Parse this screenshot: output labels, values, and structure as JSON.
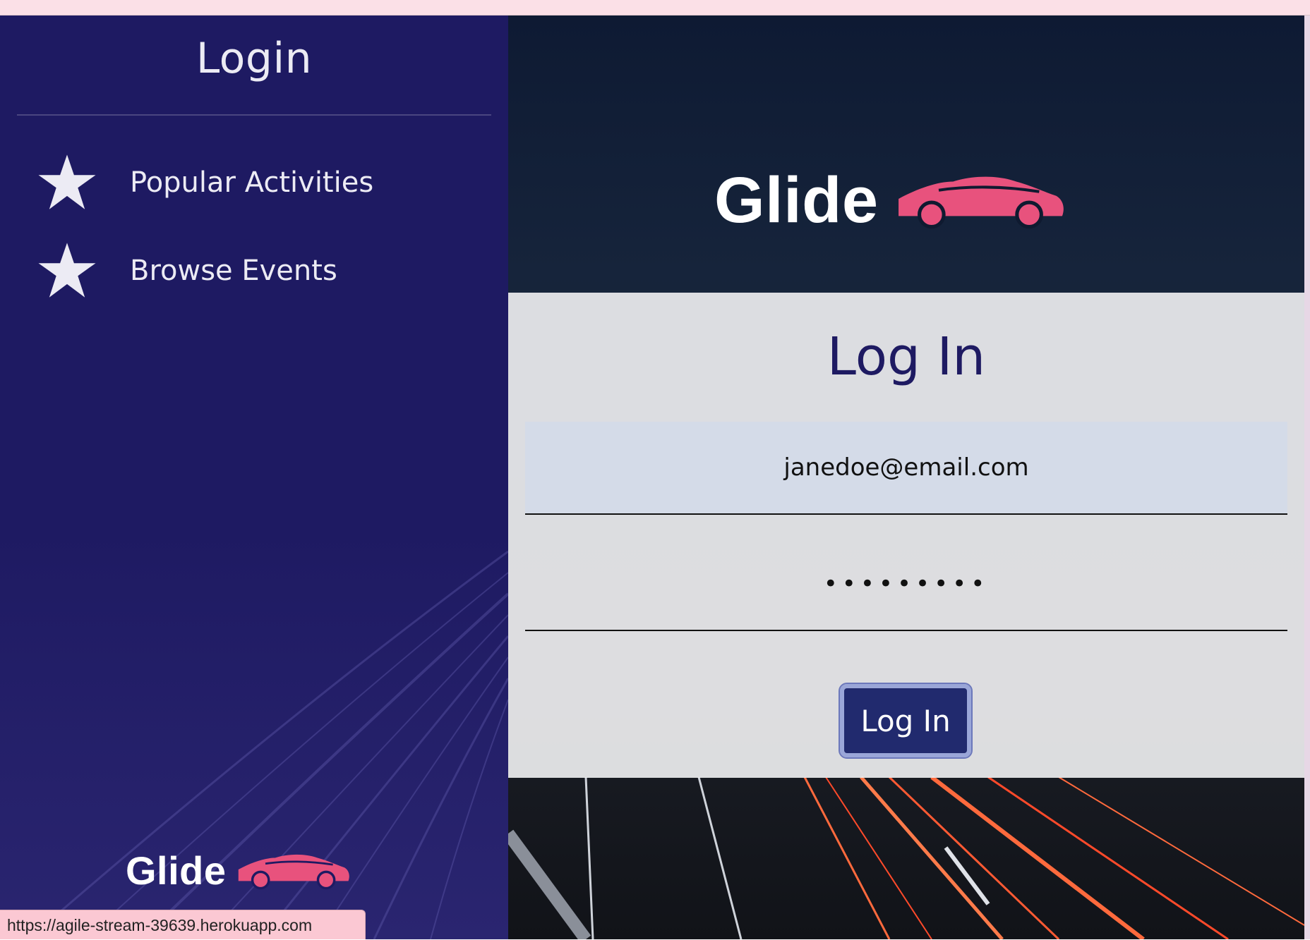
{
  "sidebar": {
    "title": "Login",
    "items": [
      {
        "label": "Popular Activities",
        "icon": "star-icon"
      },
      {
        "label": "Browse Events",
        "icon": "star-icon"
      }
    ],
    "logo_text": "Glide",
    "logo_icon": "car-icon"
  },
  "header": {
    "brand_text": "Glide",
    "brand_icon": "car-icon"
  },
  "login_form": {
    "heading": "Log In",
    "email_value": "janedoe@email.com",
    "password_value": "•••••••••",
    "submit_label": "Log In"
  },
  "status_bar": {
    "url": "https://agile-stream-39639.herokuapp.com"
  },
  "colors": {
    "sidebar_bg": "#1e1a62",
    "brand_accent": "#e8527d",
    "button_bg": "#212a6e",
    "heading_text": "#1e1a62"
  }
}
